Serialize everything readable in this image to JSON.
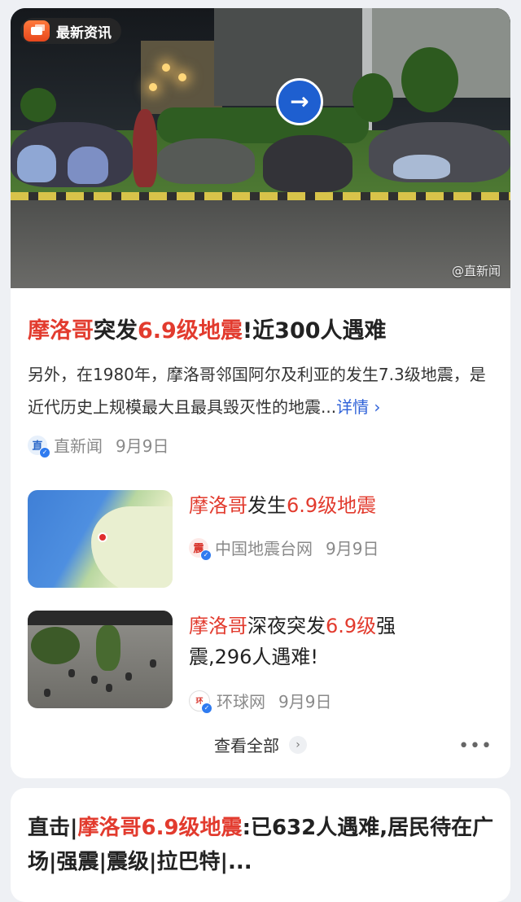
{
  "card1": {
    "badge_label": "最新资讯",
    "hero_watermark": "@直新闻",
    "sign_arrow": "→",
    "title_parts": [
      "摩洛哥",
      "突发",
      "6.9级地震",
      "!近300人遇难"
    ],
    "summary": "另外，在1980年，摩洛哥邻国阿尔及利亚的发生7.3级地震，是近代历史上规模最大且最具毁灭性的地震...",
    "summary_more": "详情 ›",
    "source": "直新闻",
    "date": "9月9日",
    "related": [
      {
        "title_parts": [
          "摩洛哥",
          "发生",
          "6.9级地震",
          ""
        ],
        "source": "中国地震台网",
        "date": "9月9日"
      },
      {
        "title_parts": [
          "摩洛哥",
          "深夜突发",
          "6.9级",
          "强震,296人遇难!"
        ],
        "source": "环球网",
        "date": "9月9日"
      }
    ],
    "view_all": "查看全部",
    "more_dots": "•••"
  },
  "card2": {
    "title_parts": [
      "直击|",
      "摩洛哥6.9级地震",
      ":已632人遇难,居民待在广场|强震|震级|拉巴特|..."
    ]
  },
  "colors": {
    "highlight": "#e23b2e",
    "link": "#2f62d8",
    "badge_orange": "#ff7a3d"
  },
  "icons": [
    "news-app-icon",
    "direction-sign-icon",
    "verified-icon",
    "chevron-right-icon",
    "more-dots-icon"
  ]
}
